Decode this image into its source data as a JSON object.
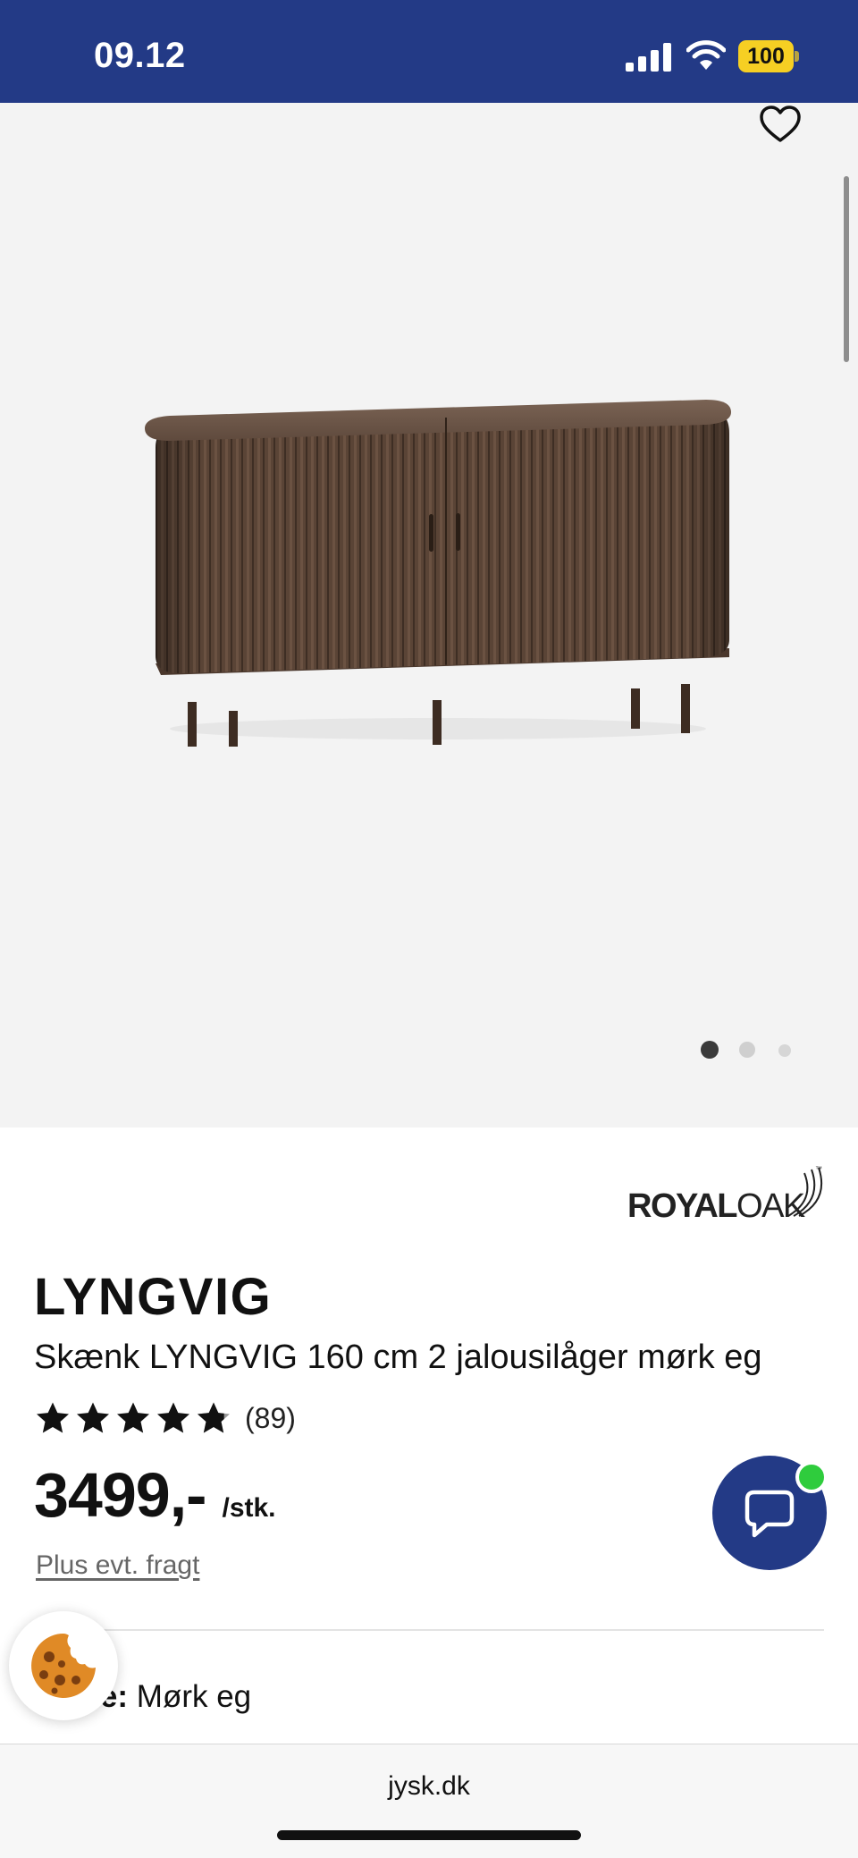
{
  "status_bar": {
    "time": "09.12",
    "battery": "100"
  },
  "gallery": {
    "current_image": 1,
    "image_count": 3
  },
  "product": {
    "brand": {
      "bold": "ROYAL",
      "light": "OAK",
      "tm": "™"
    },
    "name": "LYNGVIG",
    "description": "Skænk LYNGVIG 160 cm 2 jalousilåger mørk eg",
    "rating": {
      "stars": 4.8,
      "count": "(89)"
    },
    "price": "3499,-",
    "unit": "/stk.",
    "shipping_note": "Plus evt. fragt",
    "color_label": "Farve:",
    "color_value": "Mørk eg"
  },
  "browser": {
    "url": "jysk.dk"
  },
  "colors": {
    "brand_blue": "#233a86",
    "online_green": "#2fcc3d",
    "battery_yellow": "#f6cf23"
  },
  "icons": [
    "signal-icon",
    "wifi-icon",
    "heart-icon",
    "star-icon",
    "chat-icon",
    "cookie-icon"
  ]
}
